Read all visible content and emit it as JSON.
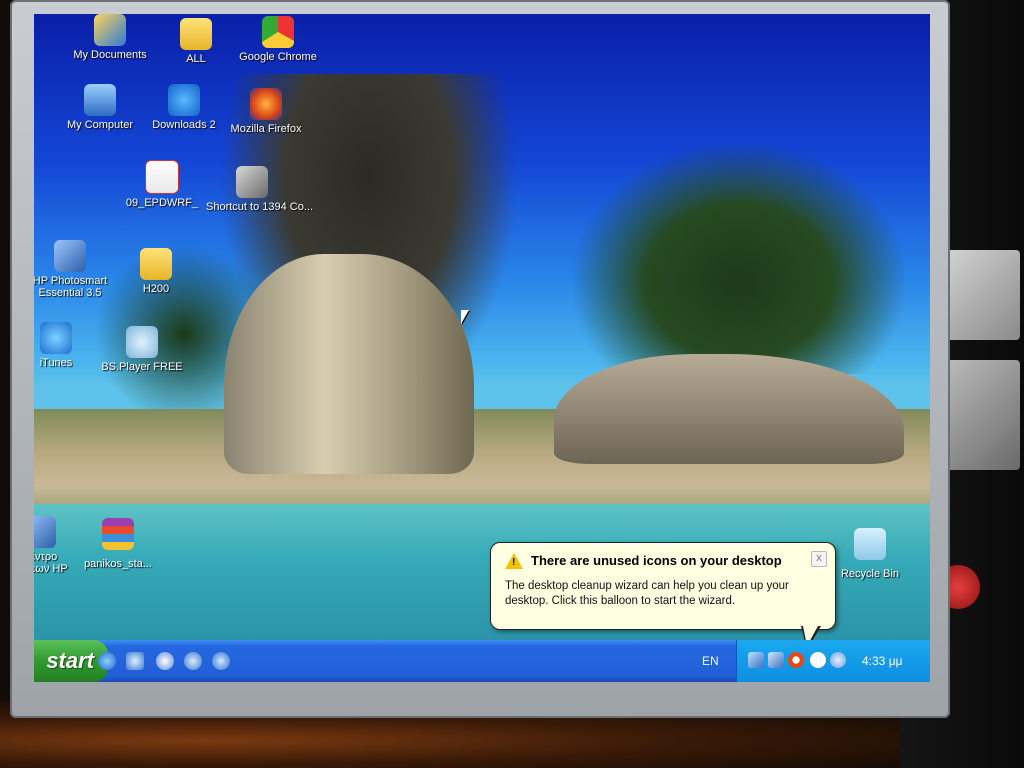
{
  "desktop": {
    "icons": [
      {
        "label": "My Documents",
        "icon": "documents-icon"
      },
      {
        "label": "ALL",
        "icon": "folder-icon"
      },
      {
        "label": "Google Chrome",
        "icon": "chrome-icon"
      },
      {
        "label": "My Computer",
        "icon": "computer-icon"
      },
      {
        "label": "Downloads 2",
        "icon": "ie-icon"
      },
      {
        "label": "Mozilla Firefox",
        "icon": "firefox-icon"
      },
      {
        "label": "09_EPDWRF_",
        "icon": "pdf-icon"
      },
      {
        "label": "Shortcut to 1394 Co...",
        "icon": "shortcut-icon"
      },
      {
        "label": "HP Photosmart Essential 3.5",
        "icon": "hp-photosmart-icon"
      },
      {
        "label": "H200",
        "icon": "folder-icon"
      },
      {
        "label": "iTunes",
        "icon": "itunes-icon"
      },
      {
        "label": "BS.Player FREE",
        "icon": "bsplayer-icon"
      },
      {
        "label": "Κέντρο λύσεων HP",
        "icon": "hp-icon"
      },
      {
        "label": "panikos_sta...",
        "icon": "winrar-icon"
      },
      {
        "label": "Recycle Bin",
        "icon": "recycle-bin-icon"
      }
    ]
  },
  "taskbar": {
    "start_label": "start",
    "language": "EN",
    "clock": "4:33 μμ"
  },
  "balloon": {
    "title": "There are unused icons on your desktop",
    "body": "The desktop cleanup wizard can help you clean up your desktop. Click this balloon to start the wizard.",
    "close_label": "x"
  },
  "colors": {
    "taskbar_blue": "#225fd8",
    "start_green": "#2f9a2f",
    "tray_blue": "#0e8ee0",
    "balloon_bg": "#ffffe1"
  }
}
